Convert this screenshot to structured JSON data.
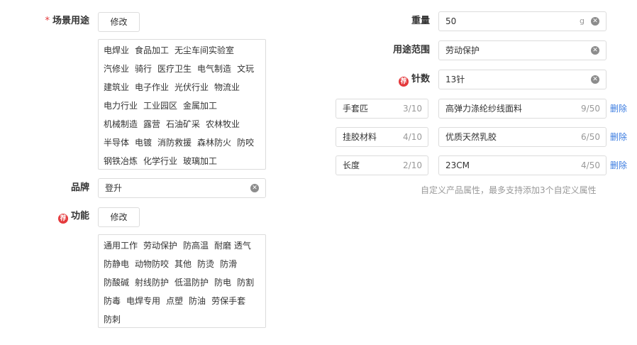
{
  "left": {
    "scene": {
      "required_mark": "*",
      "label": "场景用途",
      "edit_button": "修改",
      "tag_lines": [
        [
          "电焊业",
          "食品加工",
          "无尘车间实验室"
        ],
        [
          "汽修业",
          "骑行",
          "医疗卫生",
          "电气制造",
          "文玩"
        ],
        [
          "建筑业",
          "电子作业",
          "光伏行业",
          "物流业"
        ],
        [
          "电力行业",
          "工业园区",
          "金属加工"
        ],
        [
          "机械制造",
          "露营",
          "石油矿采",
          "农林牧业"
        ],
        [
          "半导体",
          "电镀",
          "消防救援",
          "森林防火",
          "防咬"
        ],
        [
          "钢铁冶炼",
          "化学行业",
          "玻璃加工"
        ]
      ]
    },
    "brand": {
      "label": "品牌",
      "value": "登升"
    },
    "function": {
      "badge": "荐",
      "label": "功能",
      "edit_button": "修改",
      "tag_lines": [
        [
          "通用工作",
          "劳动保护",
          "防高温",
          "耐磨 透气"
        ],
        [
          "防静电",
          "动物防咬",
          "其他",
          "防烫",
          "防滑"
        ],
        [
          "防酸碱",
          "射线防护",
          "低温防护",
          "防电",
          "防割"
        ],
        [
          "防毒",
          "电焊专用",
          "点塑",
          "防油",
          "劳保手套"
        ],
        [
          "防刺"
        ]
      ]
    }
  },
  "right": {
    "weight": {
      "label": "重量",
      "value": "50",
      "unit": "g"
    },
    "usage": {
      "label": "用途范围",
      "value": "劳动保护"
    },
    "needle": {
      "badge": "荐",
      "label": "针数",
      "value": "13针"
    },
    "custom_attributes": [
      {
        "name": "手套匹",
        "name_count": "3/10",
        "value": "高弹力涤纶纱线面料",
        "value_count": "9/50",
        "delete": "删除"
      },
      {
        "name": "挂胶材料",
        "name_count": "4/10",
        "value": "优质天然乳胶",
        "value_count": "6/50",
        "delete": "删除"
      },
      {
        "name": "长度",
        "name_count": "2/10",
        "value": "23CM",
        "value_count": "4/50",
        "delete": "删除"
      }
    ],
    "hint": "自定义产品属性，最多支持添加3个自定义属性"
  },
  "icons": {
    "clear": "clear-circle-icon",
    "badge": "recommend-badge-icon"
  },
  "colors": {
    "required": "#e4393c",
    "badge": "#e4393c",
    "link": "#3a7be0",
    "border": "#dcdcdc",
    "hint": "#999999"
  }
}
